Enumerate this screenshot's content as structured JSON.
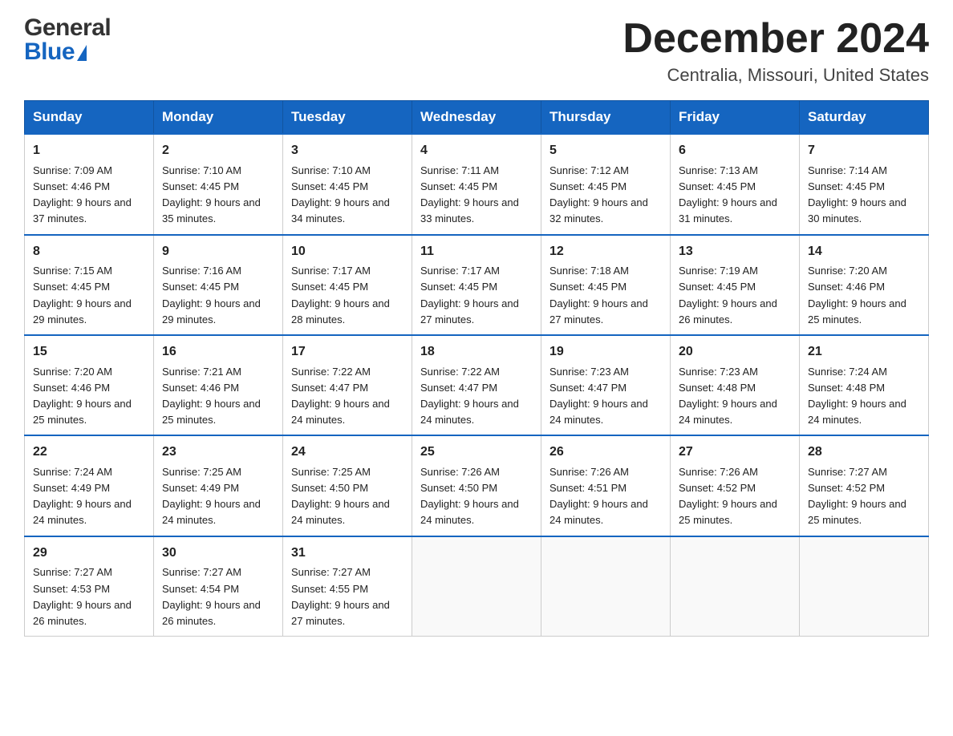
{
  "header": {
    "month_title": "December 2024",
    "location": "Centralia, Missouri, United States"
  },
  "logo": {
    "general": "General",
    "blue": "Blue"
  },
  "days_of_week": [
    "Sunday",
    "Monday",
    "Tuesday",
    "Wednesday",
    "Thursday",
    "Friday",
    "Saturday"
  ],
  "weeks": [
    [
      {
        "day": "1",
        "sunrise": "7:09 AM",
        "sunset": "4:46 PM",
        "daylight": "9 hours and 37 minutes."
      },
      {
        "day": "2",
        "sunrise": "7:10 AM",
        "sunset": "4:45 PM",
        "daylight": "9 hours and 35 minutes."
      },
      {
        "day": "3",
        "sunrise": "7:10 AM",
        "sunset": "4:45 PM",
        "daylight": "9 hours and 34 minutes."
      },
      {
        "day": "4",
        "sunrise": "7:11 AM",
        "sunset": "4:45 PM",
        "daylight": "9 hours and 33 minutes."
      },
      {
        "day": "5",
        "sunrise": "7:12 AM",
        "sunset": "4:45 PM",
        "daylight": "9 hours and 32 minutes."
      },
      {
        "day": "6",
        "sunrise": "7:13 AM",
        "sunset": "4:45 PM",
        "daylight": "9 hours and 31 minutes."
      },
      {
        "day": "7",
        "sunrise": "7:14 AM",
        "sunset": "4:45 PM",
        "daylight": "9 hours and 30 minutes."
      }
    ],
    [
      {
        "day": "8",
        "sunrise": "7:15 AM",
        "sunset": "4:45 PM",
        "daylight": "9 hours and 29 minutes."
      },
      {
        "day": "9",
        "sunrise": "7:16 AM",
        "sunset": "4:45 PM",
        "daylight": "9 hours and 29 minutes."
      },
      {
        "day": "10",
        "sunrise": "7:17 AM",
        "sunset": "4:45 PM",
        "daylight": "9 hours and 28 minutes."
      },
      {
        "day": "11",
        "sunrise": "7:17 AM",
        "sunset": "4:45 PM",
        "daylight": "9 hours and 27 minutes."
      },
      {
        "day": "12",
        "sunrise": "7:18 AM",
        "sunset": "4:45 PM",
        "daylight": "9 hours and 27 minutes."
      },
      {
        "day": "13",
        "sunrise": "7:19 AM",
        "sunset": "4:45 PM",
        "daylight": "9 hours and 26 minutes."
      },
      {
        "day": "14",
        "sunrise": "7:20 AM",
        "sunset": "4:46 PM",
        "daylight": "9 hours and 25 minutes."
      }
    ],
    [
      {
        "day": "15",
        "sunrise": "7:20 AM",
        "sunset": "4:46 PM",
        "daylight": "9 hours and 25 minutes."
      },
      {
        "day": "16",
        "sunrise": "7:21 AM",
        "sunset": "4:46 PM",
        "daylight": "9 hours and 25 minutes."
      },
      {
        "day": "17",
        "sunrise": "7:22 AM",
        "sunset": "4:47 PM",
        "daylight": "9 hours and 24 minutes."
      },
      {
        "day": "18",
        "sunrise": "7:22 AM",
        "sunset": "4:47 PM",
        "daylight": "9 hours and 24 minutes."
      },
      {
        "day": "19",
        "sunrise": "7:23 AM",
        "sunset": "4:47 PM",
        "daylight": "9 hours and 24 minutes."
      },
      {
        "day": "20",
        "sunrise": "7:23 AM",
        "sunset": "4:48 PM",
        "daylight": "9 hours and 24 minutes."
      },
      {
        "day": "21",
        "sunrise": "7:24 AM",
        "sunset": "4:48 PM",
        "daylight": "9 hours and 24 minutes."
      }
    ],
    [
      {
        "day": "22",
        "sunrise": "7:24 AM",
        "sunset": "4:49 PM",
        "daylight": "9 hours and 24 minutes."
      },
      {
        "day": "23",
        "sunrise": "7:25 AM",
        "sunset": "4:49 PM",
        "daylight": "9 hours and 24 minutes."
      },
      {
        "day": "24",
        "sunrise": "7:25 AM",
        "sunset": "4:50 PM",
        "daylight": "9 hours and 24 minutes."
      },
      {
        "day": "25",
        "sunrise": "7:26 AM",
        "sunset": "4:50 PM",
        "daylight": "9 hours and 24 minutes."
      },
      {
        "day": "26",
        "sunrise": "7:26 AM",
        "sunset": "4:51 PM",
        "daylight": "9 hours and 24 minutes."
      },
      {
        "day": "27",
        "sunrise": "7:26 AM",
        "sunset": "4:52 PM",
        "daylight": "9 hours and 25 minutes."
      },
      {
        "day": "28",
        "sunrise": "7:27 AM",
        "sunset": "4:52 PM",
        "daylight": "9 hours and 25 minutes."
      }
    ],
    [
      {
        "day": "29",
        "sunrise": "7:27 AM",
        "sunset": "4:53 PM",
        "daylight": "9 hours and 26 minutes."
      },
      {
        "day": "30",
        "sunrise": "7:27 AM",
        "sunset": "4:54 PM",
        "daylight": "9 hours and 26 minutes."
      },
      {
        "day": "31",
        "sunrise": "7:27 AM",
        "sunset": "4:55 PM",
        "daylight": "9 hours and 27 minutes."
      },
      null,
      null,
      null,
      null
    ]
  ],
  "labels": {
    "sunrise": "Sunrise:",
    "sunset": "Sunset:",
    "daylight": "Daylight:"
  }
}
